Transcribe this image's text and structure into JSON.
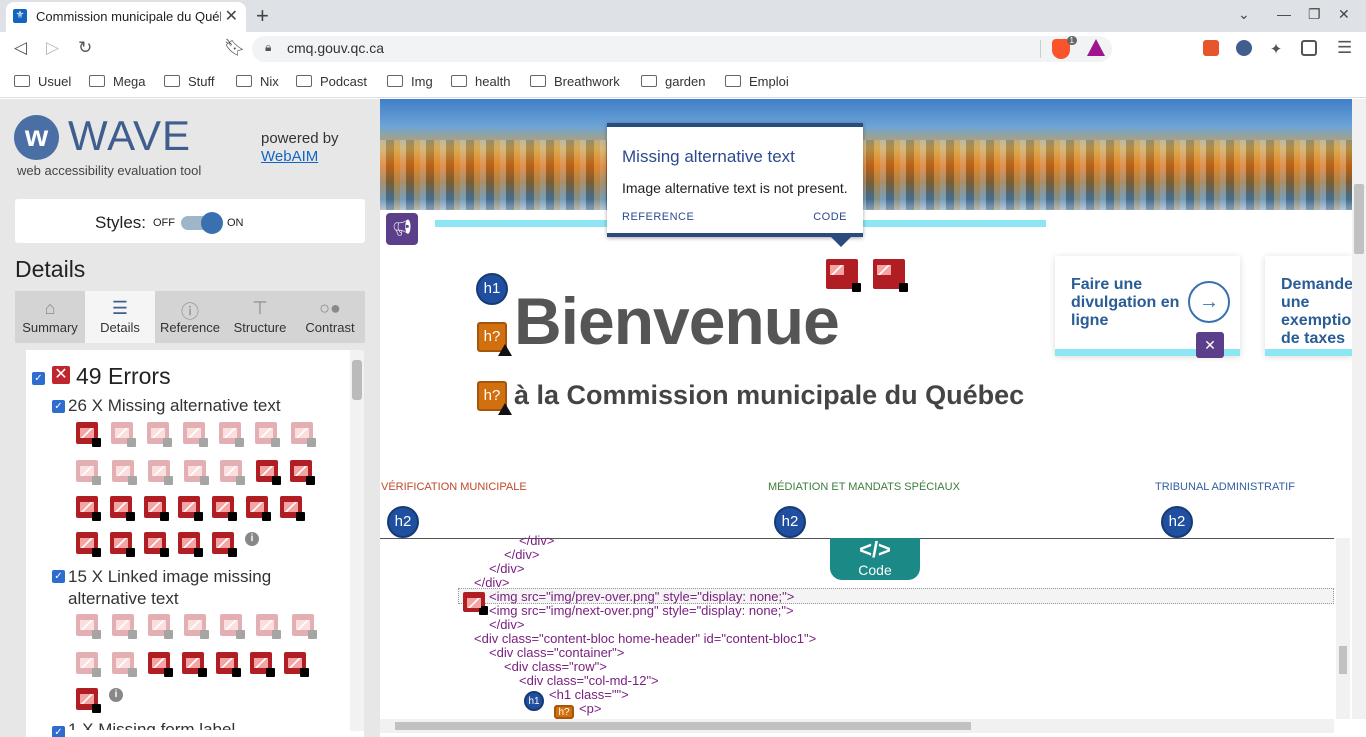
{
  "browser": {
    "tab_title": "Commission municipale du Québec",
    "url": "cmq.gouv.qc.ca",
    "brave_badge": "1",
    "bookmarks": [
      "Usuel",
      "Mega",
      "Stuff",
      "Nix",
      "Podcast",
      "Img",
      "health",
      "Breathwork",
      "garden",
      "Emploi"
    ]
  },
  "wave": {
    "logo_text": "WAVE",
    "subtitle": "web accessibility evaluation tool",
    "powered_by": "powered by",
    "webaim_link": "WebAIM",
    "styles_label": "Styles:",
    "styles_off": "OFF",
    "styles_on": "ON",
    "details_heading": "Details",
    "tabs": [
      {
        "label": "Summary",
        "icon": "home-icon"
      },
      {
        "label": "Details",
        "icon": "list-icon"
      },
      {
        "label": "Reference",
        "icon": "info-icon"
      },
      {
        "label": "Structure",
        "icon": "sitemap-icon"
      },
      {
        "label": "Contrast",
        "icon": "contrast-icon"
      }
    ],
    "errors_count_label": "49 Errors",
    "groups": [
      {
        "label": "26 X Missing alternative text"
      },
      {
        "label": "15 X Linked image missing alternative text"
      },
      {
        "label": "1 X Missing form label"
      }
    ]
  },
  "popup": {
    "title": "Missing alternative text",
    "body": "Image alternative text is not present.",
    "reference": "REFERENCE",
    "code": "CODE"
  },
  "page": {
    "h1_icon": "h1",
    "hq_icon": "h?",
    "h2_icon": "h2",
    "heading": "Bienvenue",
    "subheading": "à la Commission municipale du Québec",
    "card1": "Faire une divulgation en ligne",
    "card2": "Demander une exemption de taxes",
    "sections": [
      "VÉRIFICATION MUNICIPALE",
      "MÉDIATION ET MANDATS SPÉCIAUX",
      "TRIBUNAL ADMINISTRATIF"
    ],
    "colors": {
      "section1": "#c0492b",
      "section2": "#3c7d3c",
      "section3": "#2f5f9e"
    }
  },
  "code": {
    "button_symbol": "</>",
    "button_label": "Code",
    "lines": [
      "</div>",
      "</div>",
      "</div>",
      "</div>",
      "<img src=\"img/prev-over.png\" style=\"display: none;\">",
      "<img src=\"img/next-over.png\" style=\"display: none;\">",
      "</div>",
      "<div class=\"content-bloc home-header\" id=\"content-bloc1\">",
      "<div class=\"container\">",
      "<div class=\"row\">",
      "<div class=\"col-md-12\">",
      "<h1 class=\"\">",
      "<p>"
    ]
  }
}
